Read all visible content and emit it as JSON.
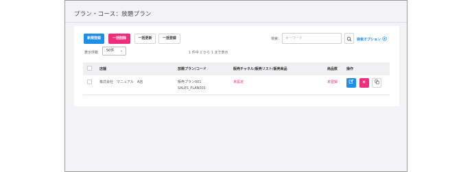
{
  "page": {
    "title": "プラン・コース：放題プラン"
  },
  "toolbar": {
    "new_label": "新規登録",
    "bulk_delete_label": "一括削除",
    "bulk_update_label": "一括更新",
    "bulk_register_label": "一括登録",
    "search_label": "検索：",
    "search_placeholder": "キーワード",
    "search_options_label": "検索オプション"
  },
  "list": {
    "per_page_label": "表示件数",
    "per_page_value": "50件",
    "count_text": "1 件中 1 から 1 まで表示"
  },
  "table": {
    "headers": [
      "店舗",
      "放題プラン/コード",
      "販売チャネル/販売リスト/販売商品",
      "商品数",
      "操作"
    ],
    "rows": [
      {
        "store": "株式会社　マニュアル　A店",
        "plan_name": "販売プラン001",
        "plan_code": "SALES_PLAN001",
        "channel": "未設定",
        "item_count": "未登録"
      }
    ]
  },
  "colors": {
    "primary": "#1e8fe8",
    "danger": "#ef2d7d"
  },
  "icons": {
    "search": "search-icon",
    "search_options": "plus-circle-icon",
    "edit": "edit-icon",
    "delete": "close-icon",
    "copy": "copy-icon"
  }
}
